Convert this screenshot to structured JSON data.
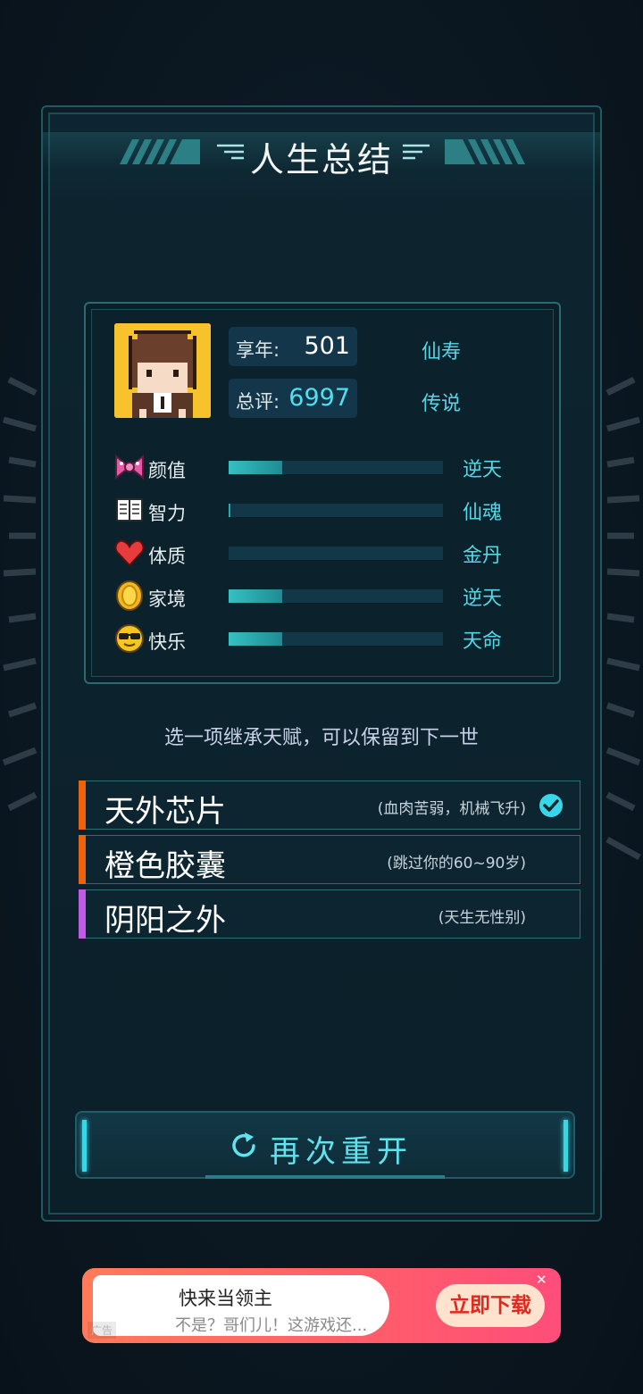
{
  "header": {
    "title": "人生总结"
  },
  "summary": {
    "age_label": "享年:",
    "age_value": "501",
    "age_grade": "仙寿",
    "score_label": "总评:",
    "score_value": "6997",
    "score_grade": "传说"
  },
  "attributes": [
    {
      "icon": "bow-icon",
      "label": "颜值",
      "level": 0.25,
      "grade": "逆天"
    },
    {
      "icon": "book-icon",
      "label": "智力",
      "level": 0.01,
      "grade": "仙魂"
    },
    {
      "icon": "heart-icon",
      "label": "体质",
      "level": 0.0,
      "grade": "金丹"
    },
    {
      "icon": "coin-icon",
      "label": "家境",
      "level": 0.25,
      "grade": "逆天"
    },
    {
      "icon": "sunglasses-face-icon",
      "label": "快乐",
      "level": 0.25,
      "grade": "天命"
    }
  ],
  "hint": "选一项继承天赋，可以保留到下一世",
  "talents": [
    {
      "name": "天外芯片",
      "desc": "(血肉苦弱，机械飞升)",
      "color": "#e8640e",
      "selected": true
    },
    {
      "name": "橙色胶囊",
      "desc": "(跳过你的60~90岁)",
      "color": "#e8640e",
      "selected": false
    },
    {
      "name": "阴阳之外",
      "desc": "(天生无性别)",
      "color": "#c05be6",
      "selected": false
    }
  ],
  "restart": {
    "label": "再次重开",
    "icon": "restart-icon"
  },
  "ad": {
    "title": "快来当领主",
    "subtitle": "不是？哥们儿！这游戏还...",
    "button": "立即下载",
    "close": "✕",
    "badge": "广告"
  },
  "colors": {
    "accent": "#4ee0ee",
    "panel_border": "#1f5a62",
    "selected_check": "#35d7e8"
  }
}
